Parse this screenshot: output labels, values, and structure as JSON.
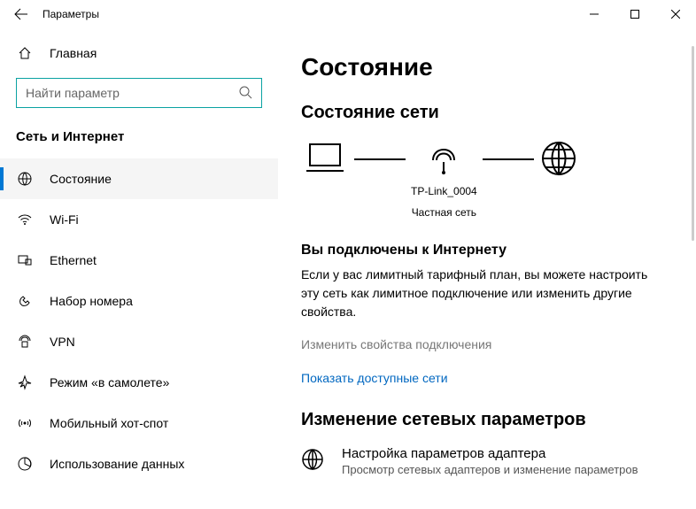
{
  "window": {
    "title": "Параметры"
  },
  "sidebar": {
    "home": "Главная",
    "search_placeholder": "Найти параметр",
    "category": "Сеть и Интернет",
    "items": [
      {
        "label": "Состояние"
      },
      {
        "label": "Wi-Fi"
      },
      {
        "label": "Ethernet"
      },
      {
        "label": "Набор номера"
      },
      {
        "label": "VPN"
      },
      {
        "label": "Режим «в самолете»"
      },
      {
        "label": "Мобильный хот-спот"
      },
      {
        "label": "Использование данных"
      }
    ]
  },
  "main": {
    "h1": "Состояние",
    "h2": "Состояние сети",
    "diagram": {
      "ssid": "TP-Link_0004",
      "net_type": "Частная сеть"
    },
    "connected_title": "Вы подключены к Интернету",
    "connected_desc": "Если у вас лимитный тарифный план, вы можете настроить эту сеть как лимитное подключение или изменить другие свойства.",
    "link_props": "Изменить свойства подключения",
    "link_networks": "Показать доступные сети",
    "h3": "Изменение сетевых параметров",
    "adapter": {
      "title": "Настройка параметров адаптера",
      "sub": "Просмотр сетевых адаптеров и изменение параметров"
    }
  }
}
